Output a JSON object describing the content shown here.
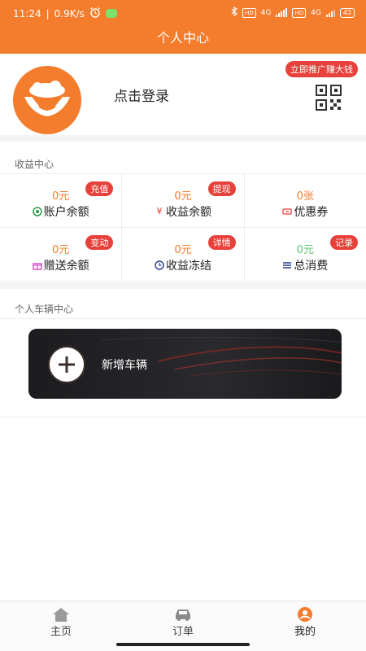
{
  "status_bar": {
    "time": "11:24",
    "speed": "0.9K/s",
    "network1": "4G",
    "network2": "4G",
    "battery": "43",
    "hd1": "HD",
    "hd2": "HD"
  },
  "header": {
    "title": "个人中心"
  },
  "profile": {
    "login_text": "点击登录",
    "promo_badge": "立即推广赚大钱"
  },
  "earnings": {
    "section_title": "收益中心",
    "cells": [
      {
        "value": "0元",
        "label": "账户余额",
        "badge": "充值",
        "icon": "coin-icon"
      },
      {
        "value": "0元",
        "label": "收益余额",
        "badge": "提现",
        "icon": "yen-icon"
      },
      {
        "value": "0张",
        "label": "优惠券",
        "badge": "",
        "icon": "ticket-icon"
      },
      {
        "value": "0元",
        "label": "赠送余额",
        "badge": "变动",
        "icon": "gift-icon"
      },
      {
        "value": "0元",
        "label": "收益冻结",
        "badge": "详情",
        "icon": "clock-icon"
      },
      {
        "value": "0元",
        "label": "总消费",
        "badge": "记录",
        "icon": "list-icon"
      }
    ],
    "icon_glyphs": {
      "yen": "¥"
    }
  },
  "vehicles": {
    "section_title": "个人车辆中心",
    "add_label": "新增车辆"
  },
  "nav": {
    "tabs": [
      {
        "label": "主页",
        "icon": "home-icon"
      },
      {
        "label": "订单",
        "icon": "car-icon"
      },
      {
        "label": "我的",
        "icon": "user-icon"
      }
    ],
    "active_index": 2
  },
  "colors": {
    "brand": "#f47c2d",
    "badge": "#e8403a",
    "value_green": "#5cc474"
  }
}
